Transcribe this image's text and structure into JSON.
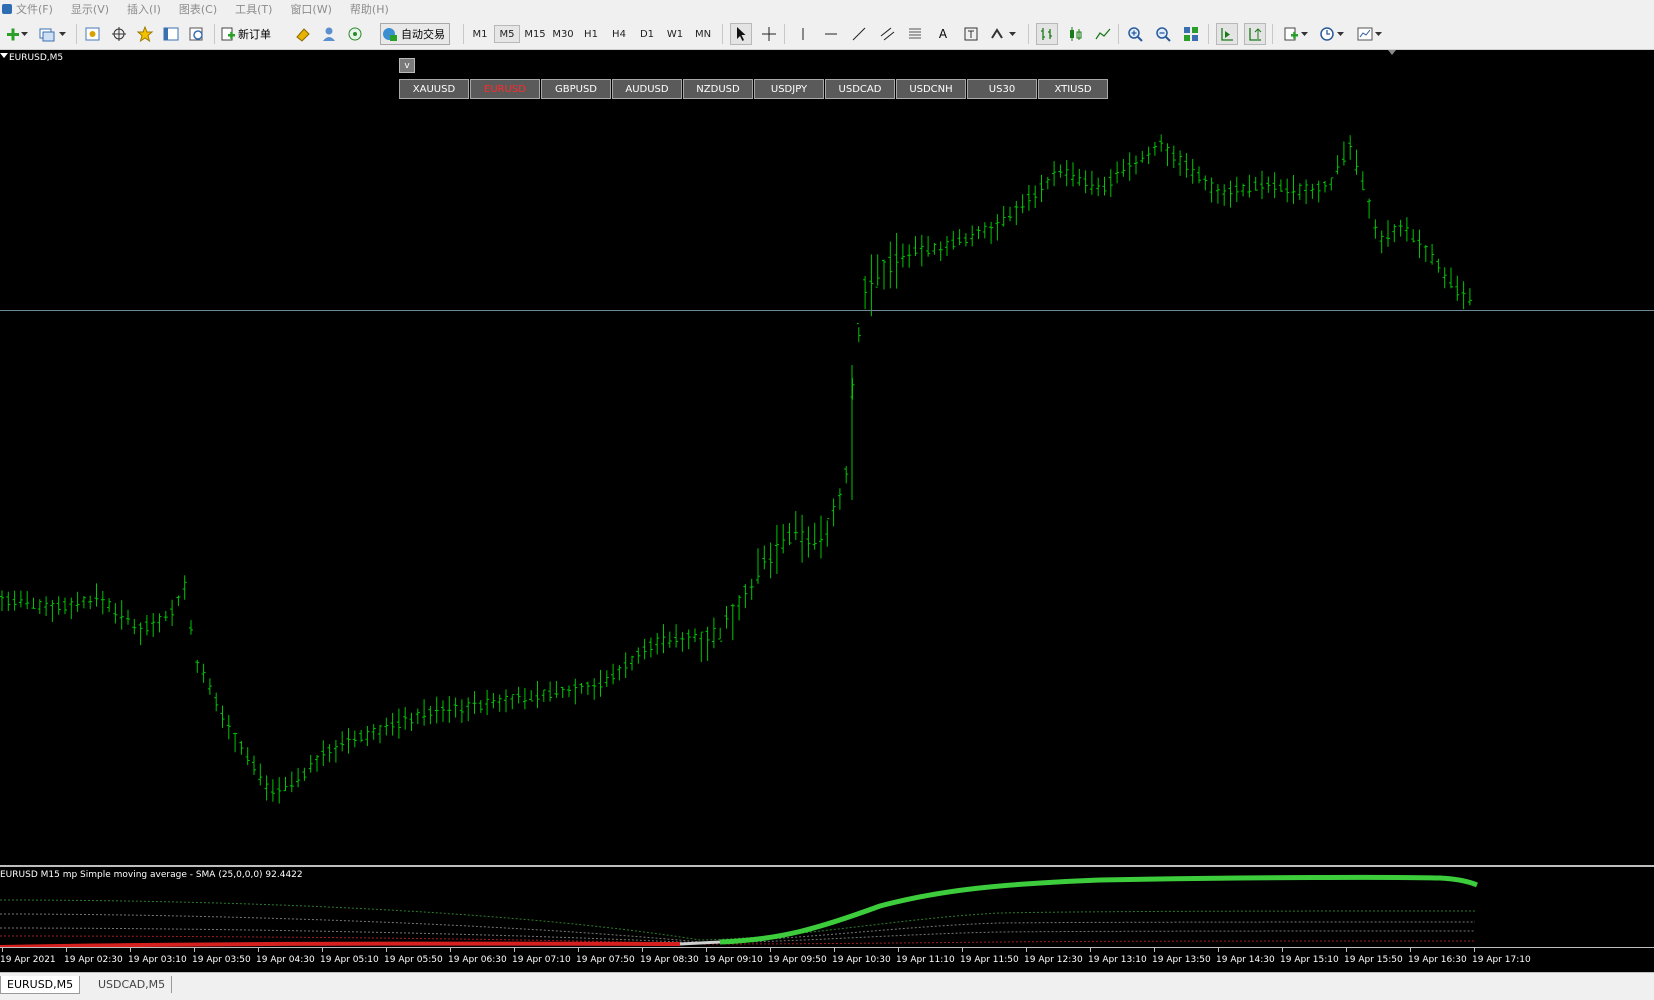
{
  "menu": [
    "文件(F)",
    "显示(V)",
    "插入(I)",
    "图表(C)",
    "工具(T)",
    "窗口(W)",
    "帮助(H)"
  ],
  "toolbar": {
    "new_order_label": "新订单",
    "auto_trade_label": "自动交易",
    "timeframes": [
      "M1",
      "M5",
      "M15",
      "M30",
      "H1",
      "H4",
      "D1",
      "W1",
      "MN"
    ],
    "active_timeframe": "M5"
  },
  "chart": {
    "title": "EURUSD,M5",
    "v_button": "v",
    "symbols": [
      "XAUUSD",
      "EURUSD",
      "GBPUSD",
      "AUDUSD",
      "NZDUSD",
      "USDJPY",
      "USDCAD",
      "USDCNH",
      "US30",
      "XTIUSD"
    ],
    "active_symbol": "EURUSD",
    "candle_color": "#00c400",
    "background": "#000000"
  },
  "indicator": {
    "title": "EURUSD M15 mp Simple moving average - SMA (25,0,0,0) 92.4422",
    "up_color": "#3ccc3c",
    "down_color": "#d62020"
  },
  "xaxis": [
    "19 Apr 2021",
    "19 Apr 02:30",
    "19 Apr 03:10",
    "19 Apr 03:50",
    "19 Apr 04:30",
    "19 Apr 05:10",
    "19 Apr 05:50",
    "19 Apr 06:30",
    "19 Apr 07:10",
    "19 Apr 07:50",
    "19 Apr 08:30",
    "19 Apr 09:10",
    "19 Apr 09:50",
    "19 Apr 10:30",
    "19 Apr 11:10",
    "19 Apr 11:50",
    "19 Apr 12:30",
    "19 Apr 13:10",
    "19 Apr 13:50",
    "19 Apr 14:30",
    "19 Apr 15:10",
    "19 Apr 15:50",
    "19 Apr 16:30",
    "19 Apr 17:10"
  ],
  "tabs": [
    "EURUSD,M5",
    "USDCAD,M5"
  ],
  "active_tab": "EURUSD,M5"
}
